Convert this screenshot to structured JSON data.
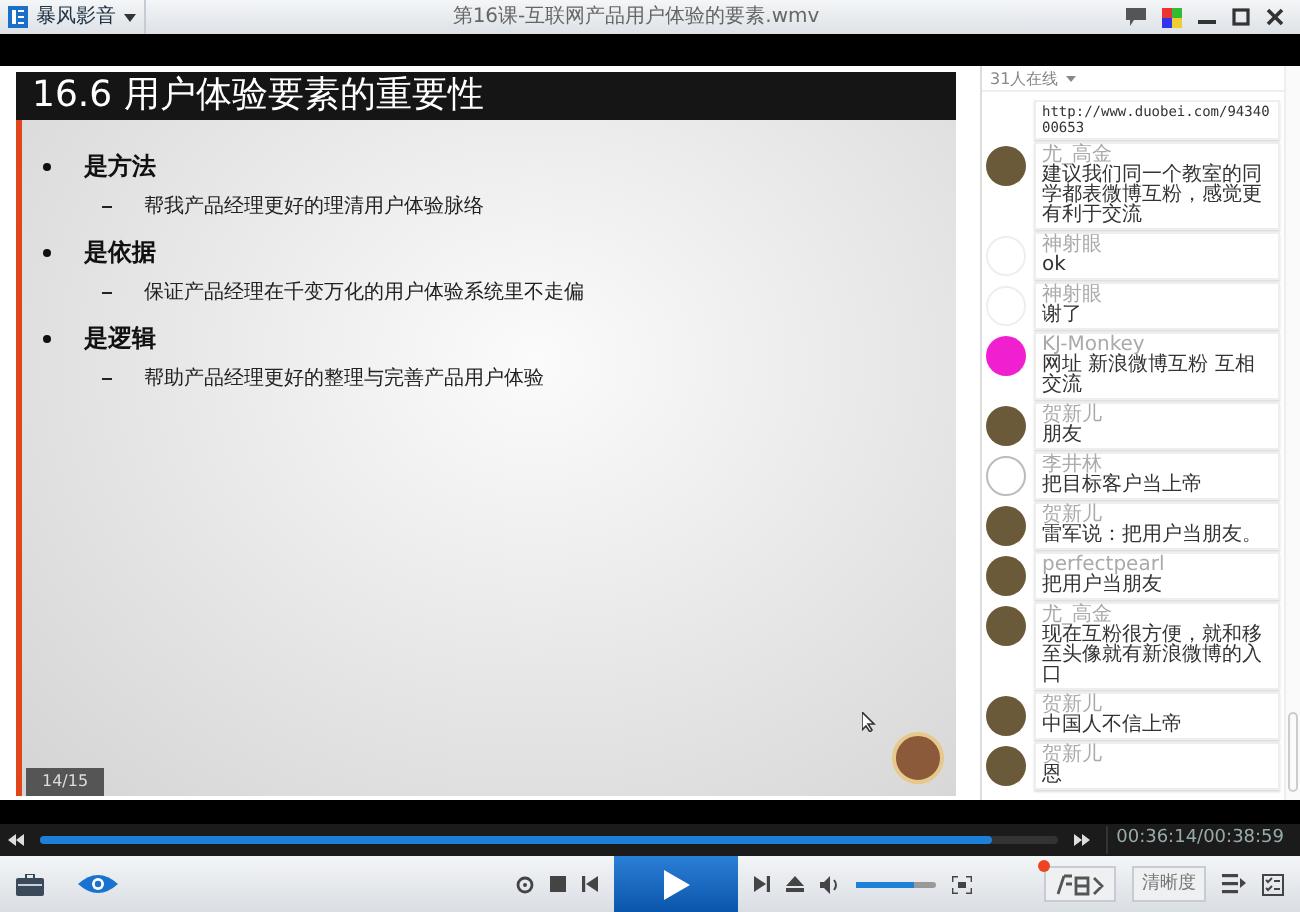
{
  "app": {
    "name": "暴风影音"
  },
  "window": {
    "title": "第16课-互联网产品用户体验的要素.wmv"
  },
  "slide": {
    "title": "16.6 用户体验要素的重要性",
    "page": "14/15",
    "bullets": [
      {
        "text": "是方法",
        "children": [
          {
            "text": "帮我产品经理更好的理清用户体验脉络"
          }
        ]
      },
      {
        "text": "是依据",
        "children": [
          {
            "text": "保证产品经理在千变万化的用户体验系统里不走偏"
          }
        ]
      },
      {
        "text": "是逻辑",
        "children": [
          {
            "text": "帮助产品经理更好的整理与完善产品用户体验"
          }
        ]
      }
    ]
  },
  "chat": {
    "online": "31人在线",
    "messages": [
      {
        "kind": "cut",
        "text": "http://www.duobei.com/9434000653"
      },
      {
        "kind": "photo",
        "name": "尤_高金",
        "text": "建议我们同一个教室的同学都表微博互粉，感觉更有利于交流"
      },
      {
        "kind": "blank",
        "name": "神射眼",
        "text": "ok"
      },
      {
        "kind": "blank",
        "name": "神射眼",
        "text": "谢了"
      },
      {
        "kind": "color",
        "color": "#f01fd0",
        "name": "KJ-Monkey",
        "text": "网址 新浪微博互粉 互相交流"
      },
      {
        "kind": "photo",
        "name": "贺新儿",
        "text": "朋友"
      },
      {
        "kind": "sketch",
        "name": "李井林",
        "text": "把目标客户当上帝"
      },
      {
        "kind": "photo",
        "name": "贺新儿",
        "text": "雷军说：把用户当朋友。"
      },
      {
        "kind": "photo",
        "name": "perfectpearl",
        "text": "把用户当朋友"
      },
      {
        "kind": "photo",
        "name": "尤_高金",
        "text": "现在互粉很方便，就和移至头像就有新浪微博的入口"
      },
      {
        "kind": "photo",
        "name": "贺新儿",
        "text": "中国人不信上帝"
      },
      {
        "kind": "photo",
        "name": "贺新儿",
        "text": "恩"
      }
    ]
  },
  "player": {
    "progress": {
      "level": 0.935
    },
    "time": "00:36:14/00:38:59",
    "volume": {
      "level": 0.72
    },
    "quality_button": "清晰度"
  }
}
